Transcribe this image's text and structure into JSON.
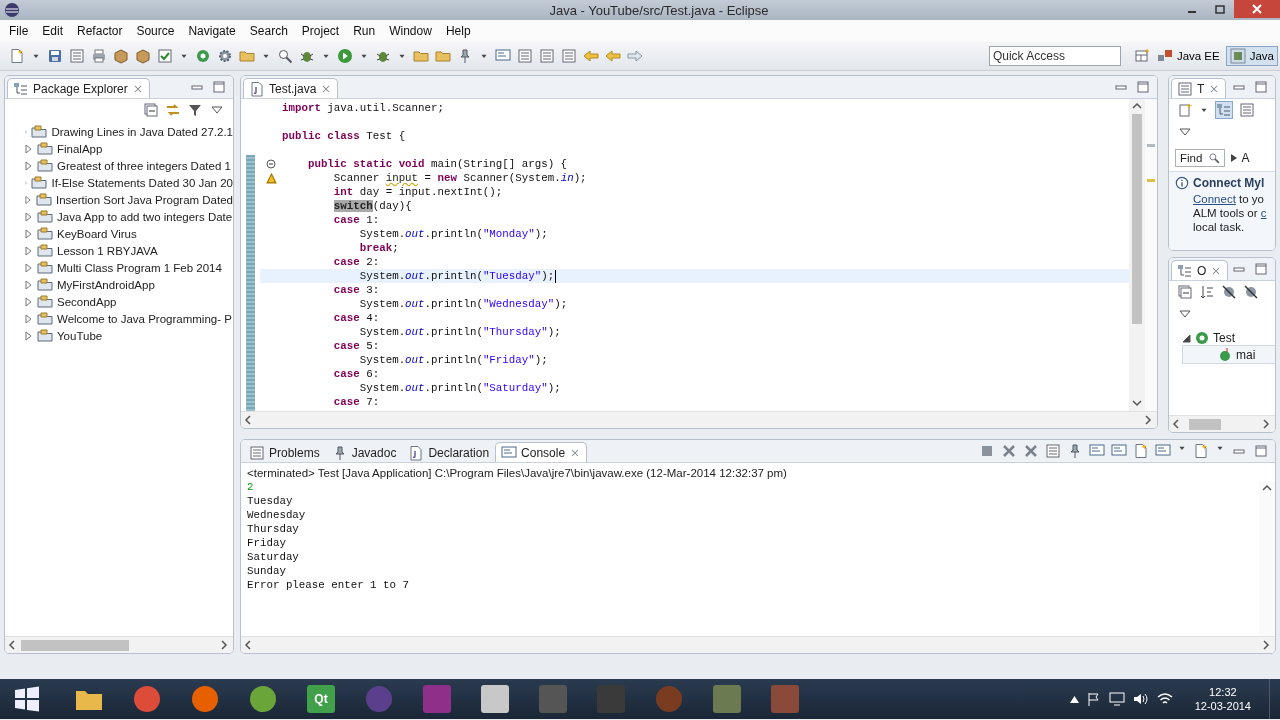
{
  "window": {
    "title": "Java - YouTube/src/Test.java - Eclipse"
  },
  "menu": [
    "File",
    "Edit",
    "Refactor",
    "Source",
    "Navigate",
    "Search",
    "Project",
    "Run",
    "Window",
    "Help"
  ],
  "quick_access": {
    "placeholder": "Quick Access"
  },
  "perspectives": [
    {
      "label": "Java EE",
      "selected": false
    },
    {
      "label": "Java",
      "selected": true
    }
  ],
  "package_explorer": {
    "tab": {
      "label": "Package Explorer",
      "selected": true
    },
    "projects": [
      {
        "name": "Drawing Lines in Java Dated 27.2.1",
        "expanded": false
      },
      {
        "name": "FinalApp",
        "expanded": false
      },
      {
        "name": "Greatest of three integers Dated 1",
        "expanded": false
      },
      {
        "name": "If-Else Statements Dated 30 Jan 20",
        "expanded": false
      },
      {
        "name": "Insertion Sort Java Program Dated",
        "expanded": false
      },
      {
        "name": "Java App to add two integers Date",
        "expanded": false
      },
      {
        "name": "KeyBoard Virus",
        "expanded": false
      },
      {
        "name": "Lesson 1 RBYJAVA",
        "expanded": false
      },
      {
        "name": "Multi Class Program 1 Feb 2014",
        "expanded": false
      },
      {
        "name": "MyFirstAndroidApp",
        "expanded": false
      },
      {
        "name": "SecondApp",
        "expanded": false
      },
      {
        "name": "Welcome to Java Programming- P",
        "expanded": false
      },
      {
        "name": "YouTube",
        "expanded": false
      }
    ]
  },
  "editor": {
    "tabs": [
      {
        "label": "Test.java",
        "selected": true
      }
    ],
    "lines": [
      {
        "current": false,
        "code": [
          {
            "kind": "keyword",
            "text": "import"
          },
          {
            "kind": "plain",
            "text": " java.util.Scanner;"
          }
        ]
      },
      {
        "current": false
      },
      {
        "current": false,
        "code": [
          {
            "kind": "keyword",
            "text": "public class"
          },
          {
            "kind": "plain",
            "text": " Test {"
          }
        ]
      },
      {
        "current": false
      },
      {
        "current": false,
        "kind": "fold",
        "code": [
          {
            "kind": "keyword",
            "text": "    public static void"
          },
          {
            "kind": "plain",
            "text": " main(String[] args) {"
          }
        ]
      },
      {
        "current": false,
        "kind": "warning",
        "code": [
          {
            "kind": "plain",
            "text": "        Scanner "
          },
          {
            "kind": "warning",
            "text": "input"
          },
          {
            "kind": "plain",
            "text": " = "
          },
          {
            "kind": "keyword",
            "text": "new"
          },
          {
            "kind": "plain",
            "text": " Scanner(System."
          },
          {
            "kind": "field",
            "text": "in"
          },
          {
            "kind": "plain",
            "text": ");"
          }
        ]
      },
      {
        "current": false,
        "code": [
          {
            "kind": "keyword",
            "text": "        int"
          },
          {
            "kind": "plain",
            "text": " day = input.nextInt();"
          }
        ]
      },
      {
        "current": false,
        "code": [
          {
            "kind": "selected",
            "text": "        switch"
          },
          {
            "kind": "plain",
            "text": "(day){"
          }
        ]
      },
      {
        "current": false,
        "code": [
          {
            "kind": "keyword",
            "text": "        case"
          },
          {
            "kind": "plain",
            "text": " 1:"
          }
        ]
      },
      {
        "current": false,
        "code": [
          {
            "kind": "plain",
            "text": "            System."
          },
          {
            "kind": "field",
            "text": "out"
          },
          {
            "kind": "plain",
            "text": ".println("
          },
          {
            "kind": "string",
            "text": "\"Monday\""
          },
          {
            "kind": "plain",
            "text": ");"
          }
        ]
      },
      {
        "current": false,
        "code": [
          {
            "kind": "keyword",
            "text": "            break"
          },
          {
            "kind": "plain",
            "text": ";"
          }
        ]
      },
      {
        "current": false,
        "code": [
          {
            "kind": "keyword",
            "text": "        case"
          },
          {
            "kind": "plain",
            "text": " 2:"
          }
        ]
      },
      {
        "current": true,
        "code": [
          {
            "kind": "plain",
            "text": "            System."
          },
          {
            "kind": "field",
            "text": "out"
          },
          {
            "kind": "plain",
            "text": ".println("
          },
          {
            "kind": "string",
            "text": "\"Tuesday\""
          },
          {
            "kind": "plain",
            "text": ");"
          }
        ]
      },
      {
        "current": false,
        "code": [
          {
            "kind": "keyword",
            "text": "        case"
          },
          {
            "kind": "plain",
            "text": " 3:"
          }
        ]
      },
      {
        "current": false,
        "code": [
          {
            "kind": "plain",
            "text": "            System."
          },
          {
            "kind": "field",
            "text": "out"
          },
          {
            "kind": "plain",
            "text": ".println("
          },
          {
            "kind": "string",
            "text": "\"Wednesday\""
          },
          {
            "kind": "plain",
            "text": ");"
          }
        ]
      },
      {
        "current": false,
        "code": [
          {
            "kind": "keyword",
            "text": "        case"
          },
          {
            "kind": "plain",
            "text": " 4:"
          }
        ]
      },
      {
        "current": false,
        "code": [
          {
            "kind": "plain",
            "text": "            System."
          },
          {
            "kind": "field",
            "text": "out"
          },
          {
            "kind": "plain",
            "text": ".println("
          },
          {
            "kind": "string",
            "text": "\"Thursday\""
          },
          {
            "kind": "plain",
            "text": ");"
          }
        ]
      },
      {
        "current": false,
        "code": [
          {
            "kind": "keyword",
            "text": "        case"
          },
          {
            "kind": "plain",
            "text": " 5:"
          }
        ]
      },
      {
        "current": false,
        "code": [
          {
            "kind": "plain",
            "text": "            System."
          },
          {
            "kind": "field",
            "text": "out"
          },
          {
            "kind": "plain",
            "text": ".println("
          },
          {
            "kind": "string",
            "text": "\"Friday\""
          },
          {
            "kind": "plain",
            "text": ");"
          }
        ]
      },
      {
        "current": false,
        "code": [
          {
            "kind": "keyword",
            "text": "        case"
          },
          {
            "kind": "plain",
            "text": " 6:"
          }
        ]
      },
      {
        "current": false,
        "code": [
          {
            "kind": "plain",
            "text": "            System."
          },
          {
            "kind": "field",
            "text": "out"
          },
          {
            "kind": "plain",
            "text": ".println("
          },
          {
            "kind": "string",
            "text": "\"Saturday\""
          },
          {
            "kind": "plain",
            "text": ");"
          }
        ]
      },
      {
        "current": false,
        "code": [
          {
            "kind": "keyword",
            "text": "        case"
          },
          {
            "kind": "plain",
            "text": " 7:"
          }
        ]
      }
    ]
  },
  "task_list": {
    "tab": {
      "label": "T",
      "selected": true
    },
    "find": {
      "value": "Find"
    },
    "filter_label": "A",
    "heading": "Connect Myl",
    "lines": [
      [
        {
          "text": "Connect",
          "link": true
        },
        {
          "text": " to yo",
          "link": false
        }
      ],
      [
        {
          "text": "ALM tools or ",
          "link": false
        },
        {
          "text": "c",
          "link": true
        }
      ],
      [
        {
          "text": "local task.",
          "link": false
        }
      ]
    ]
  },
  "outline": {
    "tab": {
      "label": "O",
      "selected": true
    },
    "tree": [
      {
        "name": "Test",
        "expanded": true,
        "selected": false,
        "children": [
          {
            "name": "mai",
            "selected": true
          }
        ]
      }
    ]
  },
  "bottom": {
    "tabs": [
      {
        "label": "Problems",
        "selected": false,
        "kind": "problems"
      },
      {
        "label": "Javadoc",
        "selected": false,
        "kind": "javadoc"
      },
      {
        "label": "Declaration",
        "selected": false,
        "kind": "declaration"
      },
      {
        "label": "Console",
        "selected": true,
        "kind": "console"
      }
    ],
    "console_header": "<terminated> Test [Java Application] C:\\Program Files\\Java\\jre7\\bin\\javaw.exe (12-Mar-2014 12:32:37 pm)",
    "console_lines": [
      {
        "kind": "input",
        "text": "2"
      },
      {
        "kind": "output",
        "text": "Tuesday"
      },
      {
        "kind": "output",
        "text": "Wednesday"
      },
      {
        "kind": "output",
        "text": "Thursday"
      },
      {
        "kind": "output",
        "text": "Friday"
      },
      {
        "kind": "output",
        "text": "Saturday"
      },
      {
        "kind": "output",
        "text": "Sunday"
      },
      {
        "kind": "output",
        "text": "Error please enter 1 to 7"
      }
    ]
  },
  "taskbar": {
    "apps": [
      {
        "kind": "folder",
        "color": "#e8b84a"
      },
      {
        "kind": "ball",
        "color": "#dd4b39"
      },
      {
        "kind": "ball",
        "color": "#e66000"
      },
      {
        "kind": "ball",
        "color": "#6aa53a"
      },
      {
        "kind": "tile",
        "color": "#41a04a",
        "label": "Qt"
      },
      {
        "kind": "ball",
        "color": "#5b3f8c"
      },
      {
        "kind": "tile",
        "color": "#8e2f8a"
      },
      {
        "kind": "tile",
        "color": "#c8c8c8"
      },
      {
        "kind": "tile",
        "color": "#555555"
      },
      {
        "kind": "tile",
        "color": "#3a3a3a"
      },
      {
        "kind": "ball",
        "color": "#7a3c20"
      },
      {
        "kind": "tile",
        "color": "#6b7a50"
      },
      {
        "kind": "tile",
        "color": "#8a4a3a"
      }
    ],
    "time": "12:32",
    "date": "12-03-2014"
  }
}
